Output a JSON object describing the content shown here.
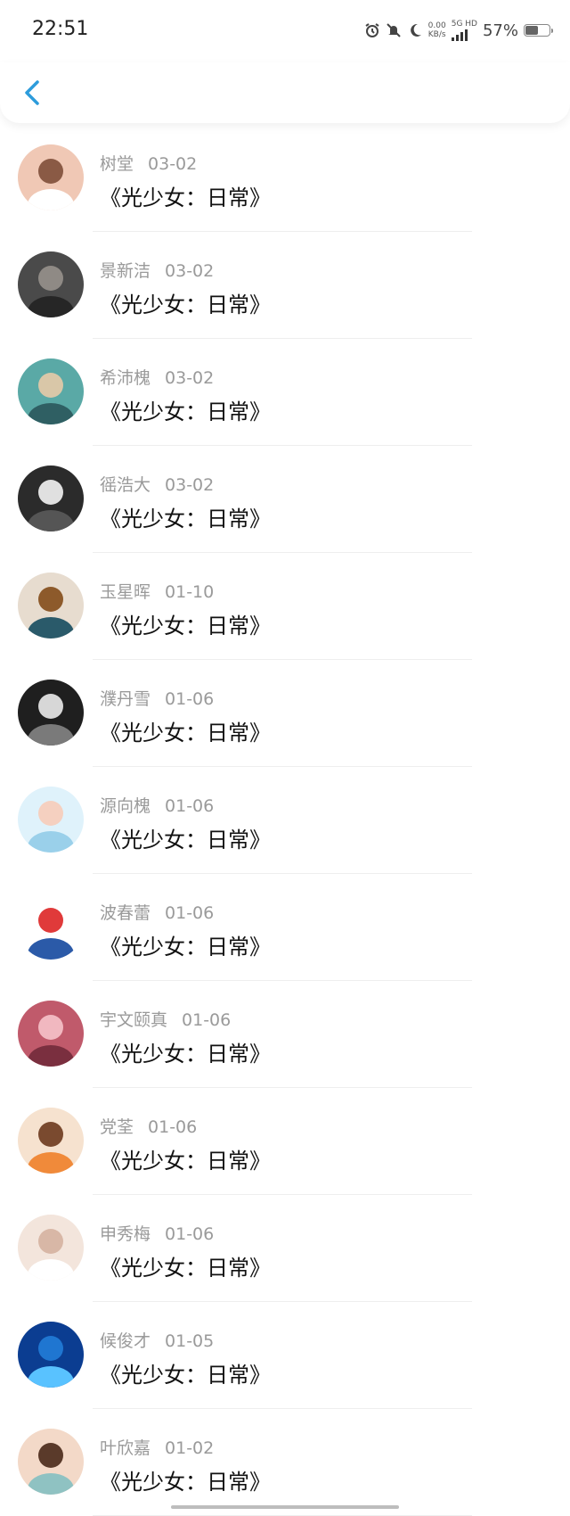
{
  "status_bar": {
    "time": "22:51",
    "net_speed_value": "0.00",
    "net_speed_unit": "KB/s",
    "net_type": "5G HD",
    "battery_percent": "57%",
    "battery_level": 0.57
  },
  "nav": {
    "back_icon": "chevron-left-icon",
    "accent_color": "#2d9cdb"
  },
  "items": [
    {
      "name": "树堂",
      "date": "03-02",
      "title": "《光少女：日常》",
      "avatar_colors": [
        "#f0c8b5",
        "#8a5a45",
        "#ffffff"
      ]
    },
    {
      "name": "景新洁",
      "date": "03-02",
      "title": "《光少女：日常》",
      "avatar_colors": [
        "#4a4a4a",
        "#8f8a85",
        "#262626"
      ]
    },
    {
      "name": "希沛槐",
      "date": "03-02",
      "title": "《光少女：日常》",
      "avatar_colors": [
        "#5aa9a6",
        "#d9c7a8",
        "#2f5f63"
      ]
    },
    {
      "name": "徭浩大",
      "date": "03-02",
      "title": "《光少女：日常》",
      "avatar_colors": [
        "#2b2b2b",
        "#e0e0e0",
        "#555555"
      ]
    },
    {
      "name": "玉星晖",
      "date": "01-10",
      "title": "《光少女：日常》",
      "avatar_colors": [
        "#e7dccf",
        "#8d5a2b",
        "#2a5a6a"
      ]
    },
    {
      "name": "濮丹雪",
      "date": "01-06",
      "title": "《光少女：日常》",
      "avatar_colors": [
        "#1f1f1f",
        "#d7d7d7",
        "#7a7a7a"
      ]
    },
    {
      "name": "源向槐",
      "date": "01-06",
      "title": "《光少女：日常》",
      "avatar_colors": [
        "#dff2fb",
        "#f5d0c0",
        "#9ad0ea"
      ]
    },
    {
      "name": "波春蕾",
      "date": "01-06",
      "title": "《光少女：日常》",
      "avatar_colors": [
        "#ffffff",
        "#e03a3a",
        "#2b5aa8"
      ]
    },
    {
      "name": "宇文颐真",
      "date": "01-06",
      "title": "《光少女：日常》",
      "avatar_colors": [
        "#c05a6b",
        "#f1b8c0",
        "#7a2f3f"
      ]
    },
    {
      "name": "党荃",
      "date": "01-06",
      "title": "《光少女：日常》",
      "avatar_colors": [
        "#f6e2cf",
        "#7a4a2f",
        "#f08a3a"
      ]
    },
    {
      "name": "申秀梅",
      "date": "01-06",
      "title": "《光少女：日常》",
      "avatar_colors": [
        "#f3e5dc",
        "#d8b7a6",
        "#ffffff"
      ]
    },
    {
      "name": "候俊才",
      "date": "01-05",
      "title": "《光少女：日常》",
      "avatar_colors": [
        "#0b3d91",
        "#1f76d1",
        "#59c2ff"
      ]
    },
    {
      "name": "叶欣嘉",
      "date": "01-02",
      "title": "《光少女：日常》",
      "avatar_colors": [
        "#f3d9c8",
        "#5a3a2a",
        "#8fc2c2"
      ]
    }
  ]
}
